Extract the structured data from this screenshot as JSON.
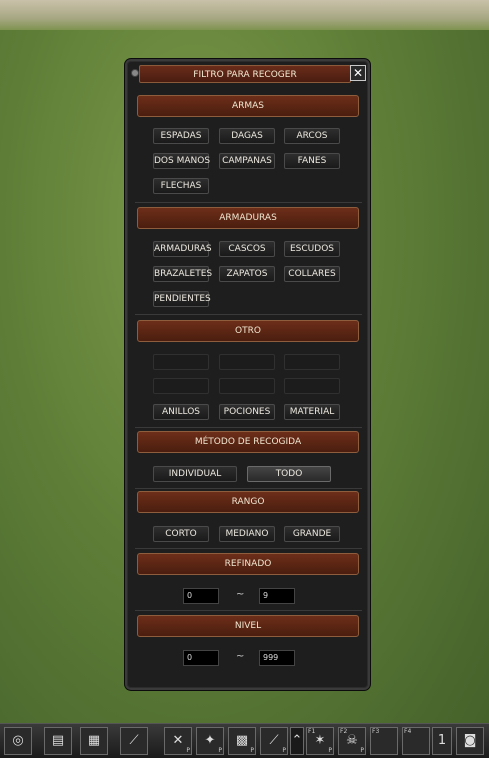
{
  "window": {
    "title": "FILTRO PARA RECOGER",
    "close_label": "✕"
  },
  "sections": {
    "armas": "ARMAS",
    "armaduras": "ARMADURAS",
    "otro": "OTRO",
    "metodo": "MÉTODO DE RECOGIDA",
    "rango": "RANGO",
    "refinado": "REFINADO",
    "nivel": "NIVEL"
  },
  "armas_buttons": [
    "ESPADAS",
    "DAGAS",
    "ARCOS",
    "DOS MANOS",
    "CAMPANAS",
    "FANES",
    "FLECHAS"
  ],
  "armaduras_buttons": [
    "ARMADURAS",
    "CASCOS",
    "ESCUDOS",
    "BRAZALETES",
    "ZAPATOS",
    "COLLARES",
    "PENDIENTES"
  ],
  "otro_buttons": [
    "ANILLOS",
    "POCIONES",
    "MATERIAL"
  ],
  "metodo_buttons": [
    "INDIVIDUAL",
    "TODO"
  ],
  "rango_buttons": [
    "CORTO",
    "MEDIANO",
    "GRANDE"
  ],
  "refinado": {
    "min": "0",
    "sep": "~",
    "max": "9"
  },
  "nivel": {
    "min": "0",
    "sep": "~",
    "max": "999"
  },
  "taskbar": {
    "keys": [
      "F1",
      "F2",
      "F3",
      "F4"
    ],
    "sub_labels": [
      "P",
      "P",
      "P",
      "P",
      "P",
      "P",
      "P"
    ],
    "level_badge": "1"
  }
}
